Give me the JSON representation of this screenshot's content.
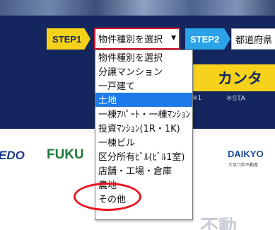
{
  "step1": {
    "label": "STEP1"
  },
  "property_select": {
    "value": "物件種別を選択",
    "arrow": "▼"
  },
  "step2": {
    "label": "STEP2"
  },
  "prefecture_select": {
    "value": "都道府県"
  },
  "banner": {
    "text": "カンタ"
  },
  "banner_note_left": "※1",
  "banner_note_right": "※STA",
  "logos": {
    "edo": "EDO",
    "fuku": "FUKU",
    "daikyo": "DAIKYO",
    "daikyo_sub": "大京穴吹不動産"
  },
  "bottom_text": "不動",
  "dropdown_options": [
    {
      "label": "物件種別を選択",
      "selected": false
    },
    {
      "label": "分譲マンション",
      "selected": false
    },
    {
      "label": "一戸建て",
      "selected": false
    },
    {
      "label": "土地",
      "selected": true
    },
    {
      "label": "一棟ｱﾊﾟｰﾄ・一棟ﾏﾝｼｮﾝ",
      "selected": false
    },
    {
      "label": "投資ﾏﾝｼｮﾝ(1R・1K)",
      "selected": false
    },
    {
      "label": "一棟ビル",
      "selected": false
    },
    {
      "label": "区分所有ﾋﾞﾙ(ﾋﾞﾙ1室)",
      "selected": false
    },
    {
      "label": "店舗・工場・倉庫",
      "selected": false
    },
    {
      "label": "農地",
      "selected": false
    },
    {
      "label": "その他",
      "selected": false
    }
  ],
  "colors": {
    "navy": "#14265e",
    "yellow": "#f5d21a",
    "blue": "#2aa3e8",
    "select_border": "#d8132a",
    "highlight": "#1e7ae8",
    "annotation": "#e8141f"
  }
}
